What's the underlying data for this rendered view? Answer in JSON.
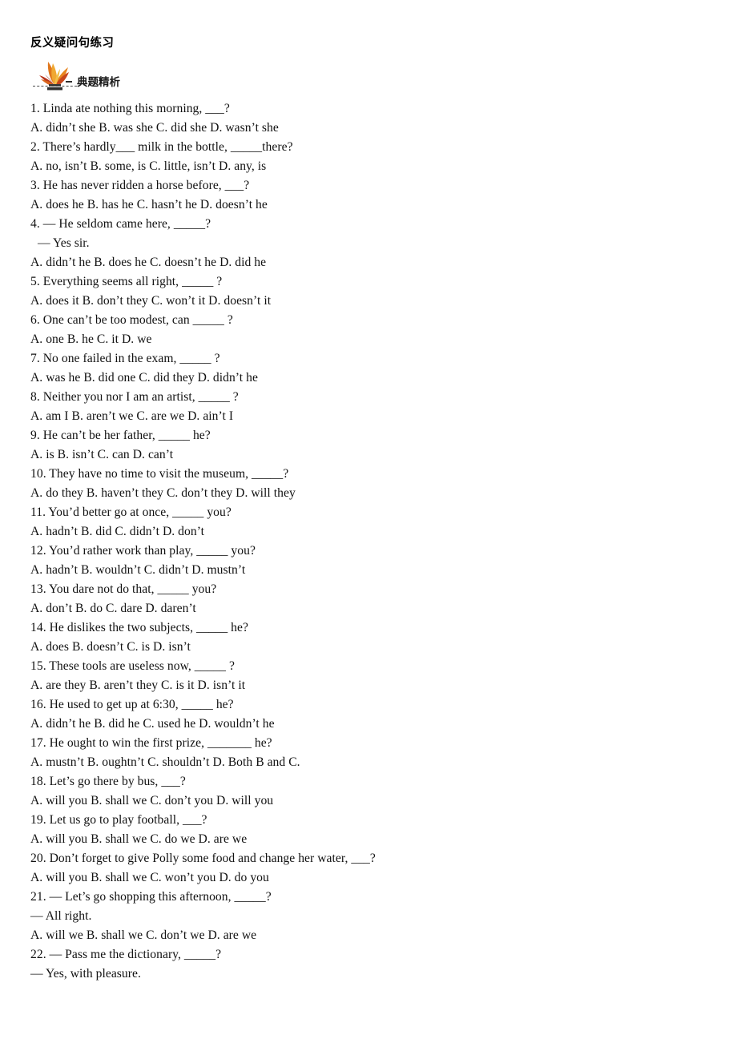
{
  "document": {
    "title": "反义疑问句练习",
    "section_label": "典题精析",
    "logo_name": "flame-leaf-logo",
    "logo_colors": {
      "flame_orange": "#e8861f",
      "flame_red": "#b8331a",
      "flame_gold": "#f0b23c",
      "dash_gray": "#4a4a4a"
    }
  },
  "lines": [
    {
      "id": "q1-stem",
      "text": "1. Linda ate nothing this morning, ___?",
      "indent": false
    },
    {
      "id": "q1-opts",
      "text": "A. didn’t she B. was she C. did she D. wasn’t she",
      "indent": false
    },
    {
      "id": "q2-stem",
      "text": "2. There’s hardly___ milk in the bottle, _____there?",
      "indent": false
    },
    {
      "id": "q2-opts",
      "text": "A. no, isn’t B. some, is C. little, isn’t D. any, is",
      "indent": false
    },
    {
      "id": "q3-stem",
      "text": "3. He has never ridden a horse before, ___?",
      "indent": false
    },
    {
      "id": "q3-opts",
      "text": "A. does he B. has he C. hasn’t he D. doesn’t he",
      "indent": false
    },
    {
      "id": "q4-stem",
      "text": "4. — He seldom came here, _____?",
      "indent": false
    },
    {
      "id": "q4-reply",
      "text": "— Yes sir.",
      "indent": true
    },
    {
      "id": "q4-opts",
      "text": "A. didn’t he B. does he C. doesn’t he D. did he",
      "indent": false
    },
    {
      "id": "q5-stem",
      "text": "5. Everything seems all right, _____ ?",
      "indent": false
    },
    {
      "id": "q5-opts",
      "text": "A. does it B. don’t they C. won’t it D. doesn’t it",
      "indent": false
    },
    {
      "id": "q6-stem",
      "text": "6. One can’t be too modest, can _____ ?",
      "indent": false
    },
    {
      "id": "q6-opts",
      "text": "A. one B. he C. it D. we",
      "indent": false
    },
    {
      "id": "q7-stem",
      "text": "7. No one failed in the exam, _____ ?",
      "indent": false
    },
    {
      "id": "q7-opts",
      "text": "A. was he B. did one C. did they D. didn’t he",
      "indent": false
    },
    {
      "id": "q8-stem",
      "text": "8. Neither you nor I am an artist, _____ ?",
      "indent": false
    },
    {
      "id": "q8-opts",
      "text": "A. am I B. aren’t we C. are we D. ain’t I",
      "indent": false
    },
    {
      "id": "q9-stem",
      "text": "9. He can’t be her father, _____ he?",
      "indent": false
    },
    {
      "id": "q9-opts",
      "text": "A. is B. isn’t C. can D. can’t",
      "indent": false
    },
    {
      "id": "q10-stem",
      "text": "10. They have no time to visit the museum, _____?",
      "indent": false
    },
    {
      "id": "q10-opts",
      "text": "A. do they B. haven’t they C. don’t they D. will they",
      "indent": false
    },
    {
      "id": "q11-stem",
      "text": "11. You’d better go at once, _____ you?",
      "indent": false
    },
    {
      "id": "q11-opts",
      "text": "A. hadn’t B. did C. didn’t D. don’t",
      "indent": false
    },
    {
      "id": "q12-stem",
      "text": "12. You’d rather work than play, _____ you?",
      "indent": false
    },
    {
      "id": "q12-opts",
      "text": "A. hadn’t B. wouldn’t C. didn’t D. mustn’t",
      "indent": false
    },
    {
      "id": "q13-stem",
      "text": "13. You dare not do that, _____ you?",
      "indent": false
    },
    {
      "id": "q13-opts",
      "text": "A. don’t B. do C. dare D. daren’t",
      "indent": false
    },
    {
      "id": "q14-stem",
      "text": "14. He dislikes the two subjects, _____ he?",
      "indent": false
    },
    {
      "id": "q14-opts",
      "text": "A. does B. doesn’t C. is D. isn’t",
      "indent": false
    },
    {
      "id": "q15-stem",
      "text": "15. These tools are useless now, _____ ?",
      "indent": false
    },
    {
      "id": "q15-opts",
      "text": "A. are they B. aren’t they C. is it D. isn’t it",
      "indent": false
    },
    {
      "id": "q16-stem",
      "text": "16. He used to get up at 6:30, _____ he?",
      "indent": false
    },
    {
      "id": "q16-opts",
      "text": "A. didn’t he B. did he C. used he D. wouldn’t he",
      "indent": false
    },
    {
      "id": "q17-stem",
      "text": "17. He ought to win the first prize, _______ he?",
      "indent": false
    },
    {
      "id": "q17-opts",
      "text": "A. mustn’t B. oughtn’t C. shouldn’t D. Both B and C.",
      "indent": false
    },
    {
      "id": "q18-stem",
      "text": "18. Let’s go there by bus, ___?",
      "indent": false
    },
    {
      "id": "q18-opts",
      "text": "A. will you B. shall we C. don’t you D. will you",
      "indent": false
    },
    {
      "id": "q19-stem",
      "text": "19. Let us go to play football, ___?",
      "indent": false
    },
    {
      "id": "q19-opts",
      "text": "A. will you B. shall we C. do we D. are we",
      "indent": false
    },
    {
      "id": "q20-stem",
      "text": "20. Don’t forget to give Polly some food and change her water, ___?",
      "indent": false
    },
    {
      "id": "q20-opts",
      "text": "A. will you B. shall we C. won’t you D. do you",
      "indent": false
    },
    {
      "id": "q21-stem",
      "text": "21. — Let’s go shopping this afternoon, _____?",
      "indent": false
    },
    {
      "id": "q21-reply",
      "text": "— All right.",
      "indent": false
    },
    {
      "id": "q21-opts",
      "text": "A. will we B. shall we C. don’t we D. are we",
      "indent": false
    },
    {
      "id": "q22-stem",
      "text": "22. — Pass me the dictionary, _____?",
      "indent": false
    },
    {
      "id": "q22-reply",
      "text": "— Yes, with pleasure.",
      "indent": false
    }
  ]
}
